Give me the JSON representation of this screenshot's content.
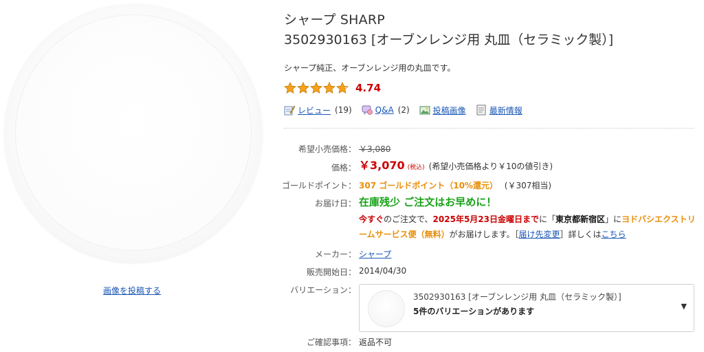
{
  "product": {
    "brand": "シャープ SHARP",
    "name": "3502930163 [オーブンレンジ用 丸皿（セラミック製）]",
    "description": "シャープ純正、オーブンレンジ用の丸皿です。",
    "rating": "4.74",
    "rating_stars": 4.74,
    "post_image_link": "画像を投稿する"
  },
  "links": {
    "review_label": "レビュー",
    "review_count": "(19)",
    "qa_label": "Q&A",
    "qa_count": "(2)",
    "posted_images_label": "投稿画像",
    "latest_info_label": "最新情報"
  },
  "specs": {
    "list_price_label": "希望小売価格",
    "list_price": "￥3,080",
    "price_label": "価格",
    "price": "￥3,070",
    "tax_note": "(税込)",
    "discount_note": "(希望小売価格より￥10の値引き)",
    "points_label": "ゴールドポイント",
    "points": "307 ゴールドポイント（10%還元）",
    "points_value": "(￥307相当)",
    "delivery_label": "お届け日",
    "stock_status": "在庫残少 ご注文はお早めに！",
    "delivery_now": "今すぐ",
    "delivery_text1": "のご注文で、",
    "delivery_date": "2025年5月23日金曜日まで",
    "delivery_text2": "に「",
    "delivery_area": "東京都新宿区",
    "delivery_text3": "」に",
    "delivery_service": "ヨドバシエクストリームサービス便（無料）",
    "delivery_text4": "がお届けします。［",
    "change_address_link": "届け先変更",
    "delivery_text5": "］詳しくは",
    "details_link": "こちら",
    "maker_label": "メーカー",
    "maker": "シャープ",
    "release_label": "販売開始日",
    "release_date": "2014/04/30",
    "variation_label": "バリエーション",
    "confirm_label": "ご確認事項",
    "confirm_value": "返品不可"
  },
  "variation": {
    "name": "3502930163 [オーブンレンジ用 丸皿（セラミック製）]",
    "count_text": "5件のバリエーションがあります",
    "arrow": "▼"
  },
  "colors": {
    "price_red": "#cc0000",
    "gold_orange": "#e88f0b",
    "stock_green": "#18a218",
    "link_blue": "#1a56b5",
    "star_fill": "#f7a21b"
  },
  "icons": [
    "star-icon",
    "review-icon",
    "qa-icon",
    "posted-images-icon",
    "latest-info-icon",
    "dropdown-arrow-icon"
  ]
}
